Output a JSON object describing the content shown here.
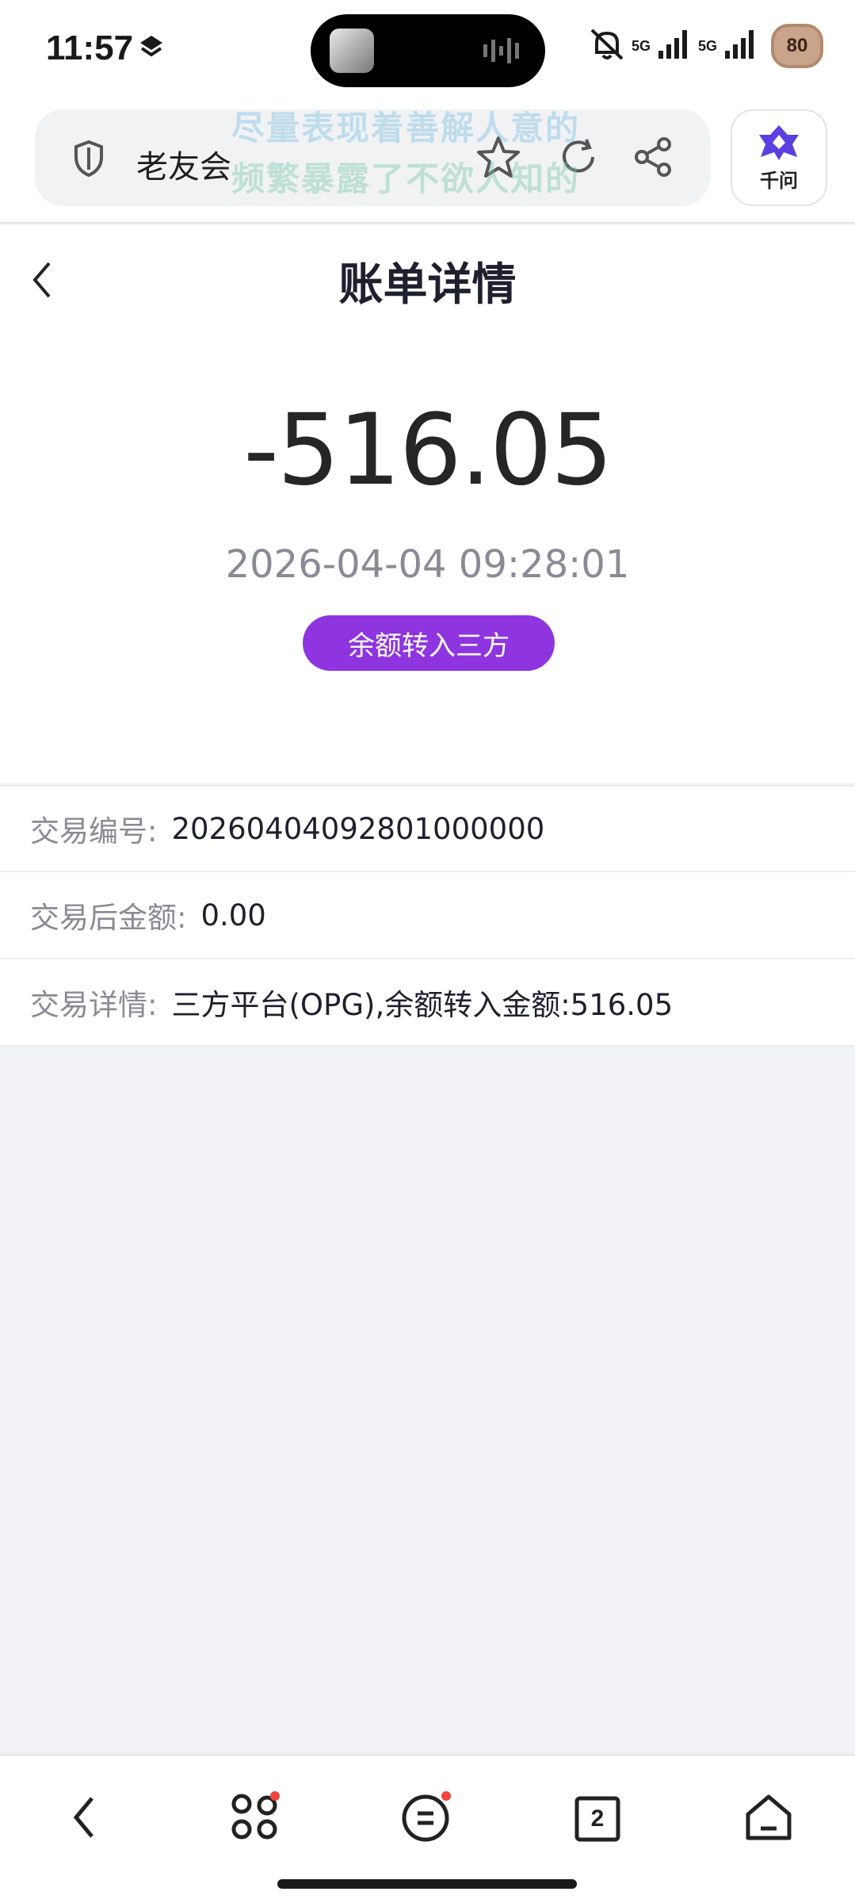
{
  "status_bar": {
    "time": "11:57",
    "network_1": "5G",
    "network_2": "5G",
    "battery": "80"
  },
  "browser": {
    "site_name": "老友会",
    "overlay_line1": "尽量表现着善解人意的",
    "overlay_line2": "频繁暴露了不欲人知的",
    "assistant_label": "千问",
    "accent_color": "#5b3fe0"
  },
  "page": {
    "title": "账单详情"
  },
  "summary": {
    "amount": "-516.05",
    "datetime": "2026-04-04 09:28:01",
    "type_badge": "余额转入三方",
    "badge_color": "#8f35e0"
  },
  "details": [
    {
      "label": "交易编号:",
      "value": "20260404092801000000"
    },
    {
      "label": "交易后金额:",
      "value": "0.00"
    },
    {
      "label": "交易详情:",
      "value": "三方平台(OPG),余额转入金额:516.05"
    }
  ],
  "bottom_nav": {
    "tab_count": "2",
    "icons": [
      "back-icon",
      "apps-icon",
      "menu-icon",
      "tabs-icon",
      "home-icon"
    ]
  }
}
